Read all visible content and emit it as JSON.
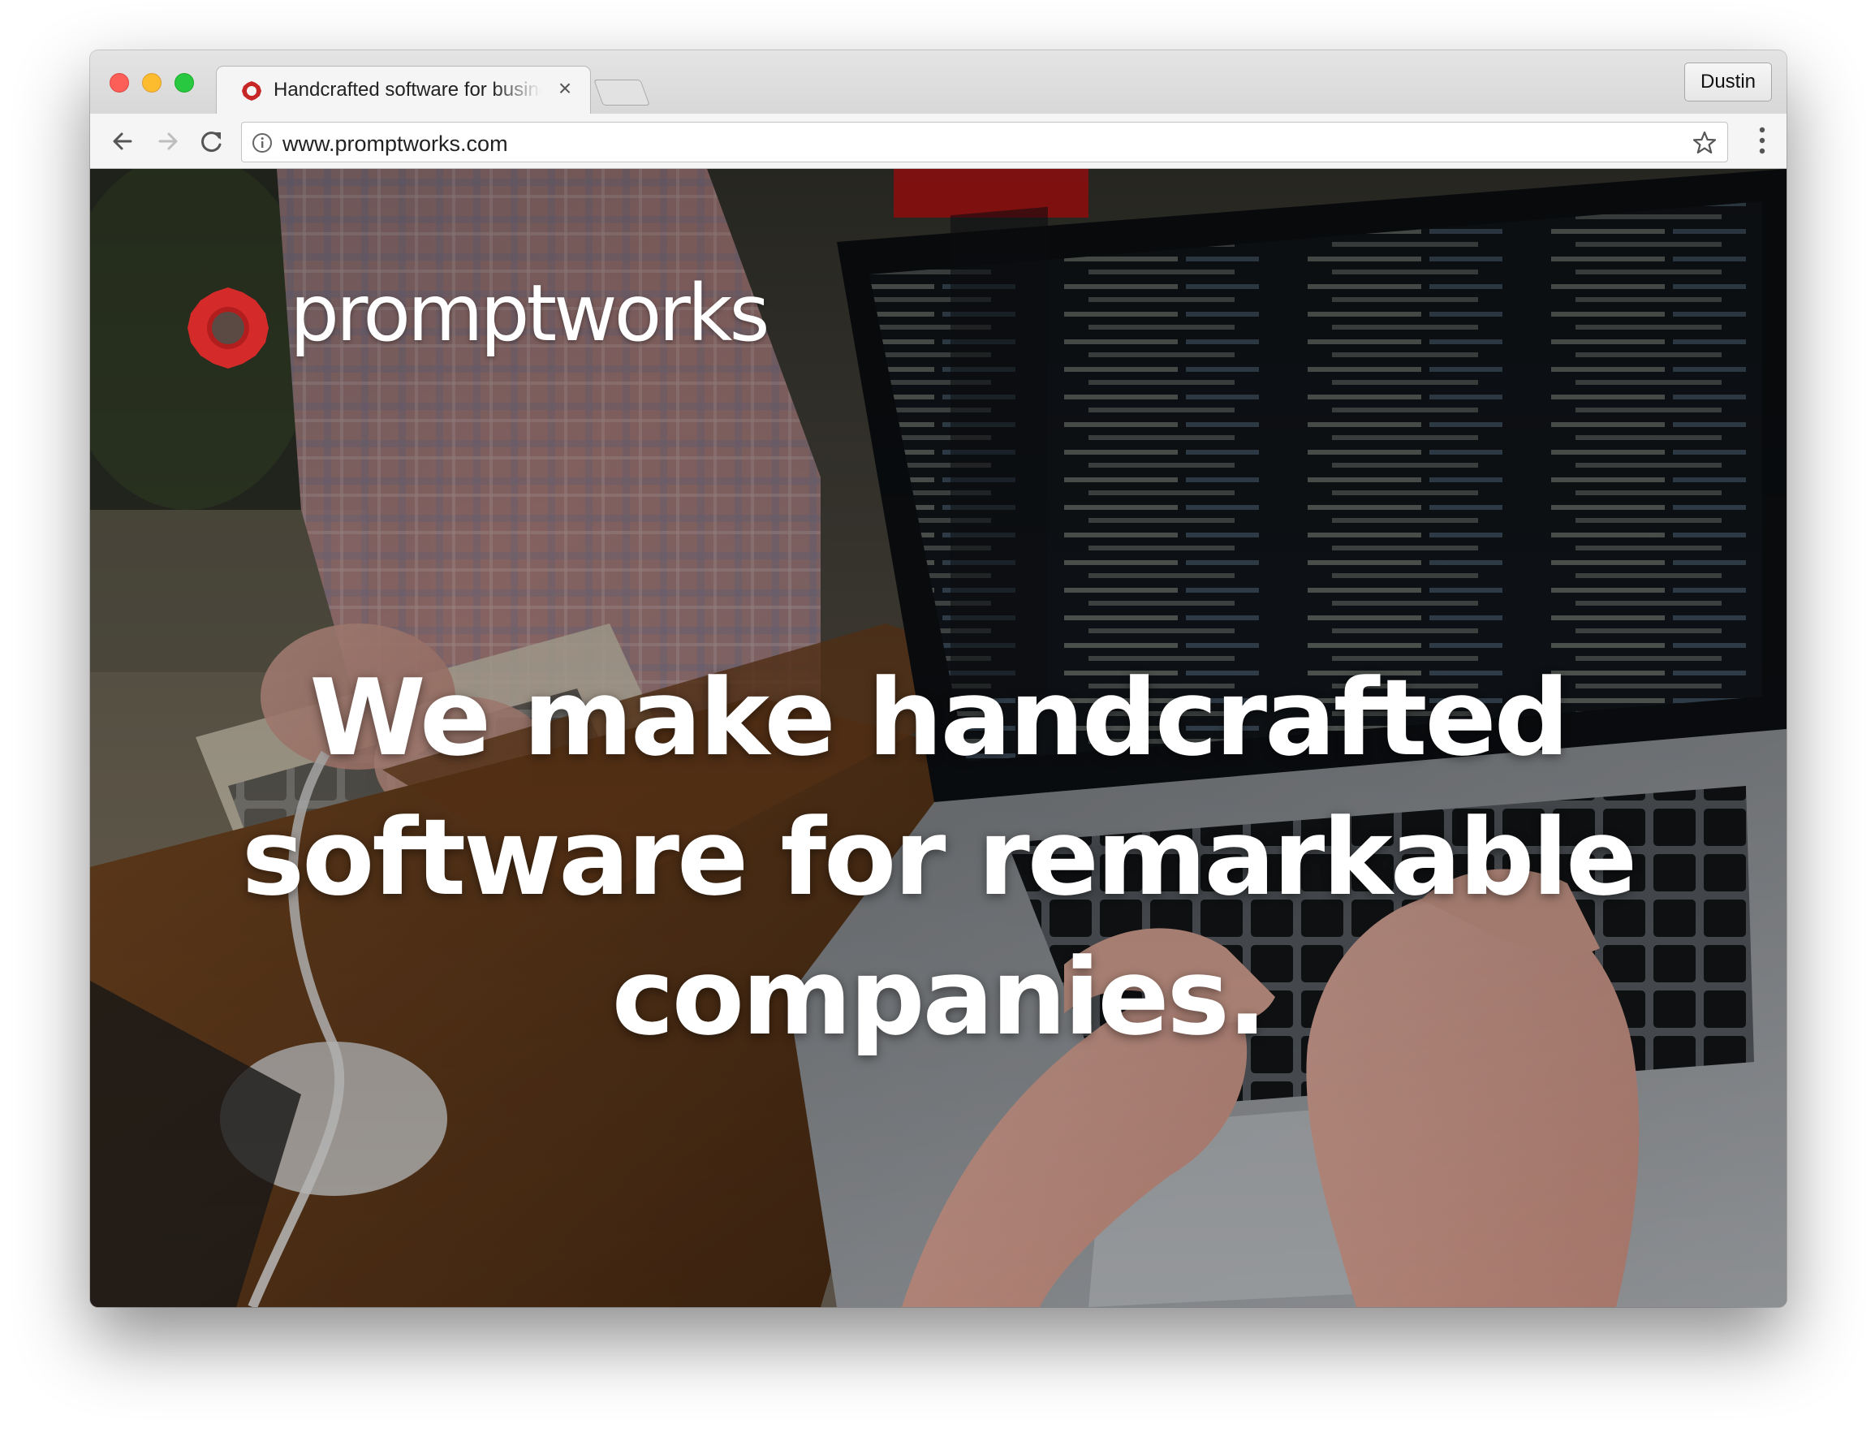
{
  "browser": {
    "tab": {
      "title": "Handcrafted software for business",
      "close_glyph": "×",
      "favicon": "promptworks-gear-icon"
    },
    "profile_name": "Dustin",
    "toolbar": {
      "back_icon": "back-arrow-icon",
      "forward_icon": "forward-arrow-icon",
      "reload_icon": "reload-icon",
      "url": "www.promptworks.com",
      "site_info_icon": "info-icon",
      "bookmark_icon": "star-icon",
      "menu_icon": "kebab-menu-icon"
    },
    "window_controls": [
      "close",
      "minimize",
      "zoom"
    ]
  },
  "page": {
    "logo_text": "promptworks",
    "logo_color": "#d42a2a",
    "headline_lines": [
      "We make handcrafted",
      "software for remarkable",
      "companies."
    ]
  }
}
